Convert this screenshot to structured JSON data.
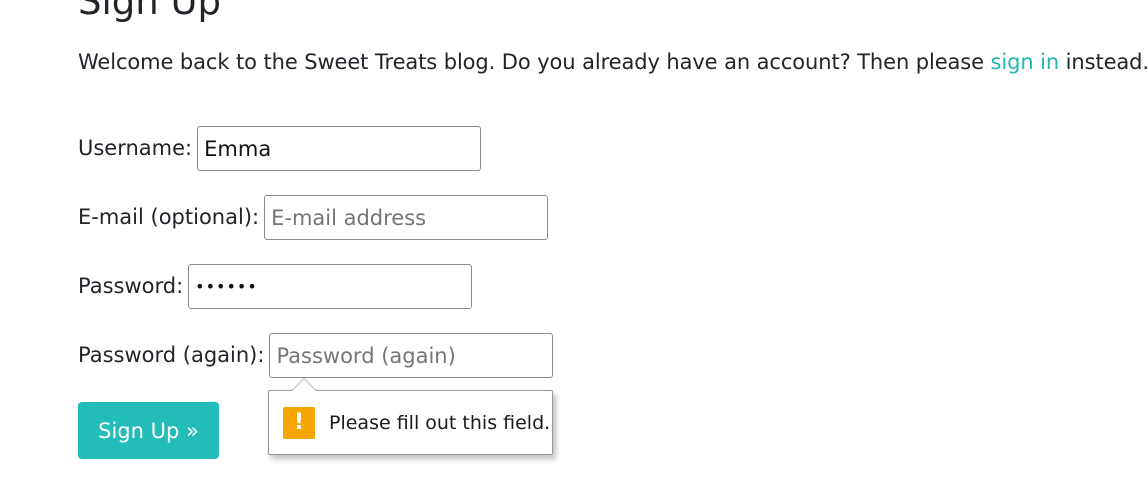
{
  "page": {
    "title": "Sign Up",
    "intro_before": "Welcome back to the Sweet Treats blog. Do you already have an account? Then please ",
    "intro_link": "sign in",
    "intro_after": " instead."
  },
  "form": {
    "username_label": "Username:",
    "username_value": "Emma",
    "email_label": "E-mail (optional):",
    "email_placeholder": "E-mail address",
    "password_label": "Password:",
    "password_value": "••••••",
    "password2_label": "Password (again):",
    "password2_placeholder": "Password (again)",
    "submit_label": "Sign Up »"
  },
  "validation": {
    "icon": "warning-icon",
    "message": "Please fill out this field."
  },
  "colors": {
    "accent": "#23bdb9",
    "warning": "#f7a600"
  }
}
